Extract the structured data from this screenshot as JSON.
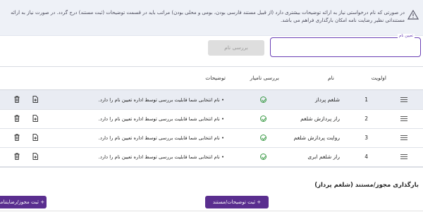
{
  "info": {
    "text_line1": "در صورتی که نام درخواستی نیاز به ارائه توضیحات بیشتری دارد (از قبیل مستند فارسی بودن، بومی و محلی بودن) مراتب باید در قسمت توضیحات (ثبت مستند) درج گردد. در صورت نیاز به ارائه",
    "text_line2": "مستنداتی نظیر رضایت نامه امکان بارگذاری فراهم می باشد.",
    "icon": "warning-triangle-icon"
  },
  "name_input": {
    "label": "تعیین نام",
    "value": ""
  },
  "check_button": "بررسی نام",
  "table": {
    "headers": {
      "priority": "اولویت",
      "name": "نام",
      "check": "بررسی نامیار",
      "desc": "توضیحات"
    },
    "rows": [
      {
        "priority": "1",
        "name": "شلغم پرداز",
        "status": "ok",
        "desc": "• نام انتخابی شما قابلیت بررسی توسط اداره تعیین نام را دارد.",
        "selected": true
      },
      {
        "priority": "2",
        "name": "راز پردازش شلغم",
        "status": "ok",
        "desc": "• نام انتخابی شما قابلیت بررسی توسط اداره تعیین نام را دارد.",
        "selected": false
      },
      {
        "priority": "3",
        "name": "روایت پردازش شلغم",
        "status": "ok",
        "desc": "• نام انتخابی شما قابلیت بررسی توسط اداره تعیین نام را دارد.",
        "selected": false
      },
      {
        "priority": "4",
        "name": "راز شلغم ابری",
        "status": "ok",
        "desc": "• نام انتخابی شما قابلیت بررسی توسط اداره تعیین نام را دارد.",
        "selected": false
      }
    ]
  },
  "upload": {
    "title": "بارگذاری مجوز/مستند (شلغم پرداز)",
    "desc_button": "+ ثبت توضیحات/مستند",
    "license_button": "+ ثبت مجوز/رضایتنامه"
  },
  "colors": {
    "accent": "#5a2e8f",
    "ok": "#3a9a46",
    "focus": "#6a3fb5"
  }
}
